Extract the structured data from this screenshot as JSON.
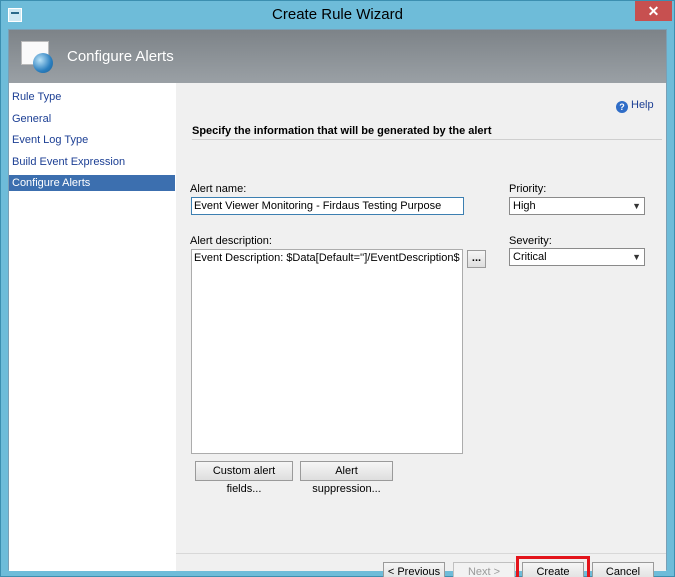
{
  "window": {
    "title": "Create Rule Wizard",
    "close_glyph": "✕"
  },
  "header": {
    "title": "Configure Alerts"
  },
  "nav": {
    "items": [
      {
        "label": "Rule Type",
        "selected": false
      },
      {
        "label": "General",
        "selected": false
      },
      {
        "label": "Event Log Type",
        "selected": false
      },
      {
        "label": "Build Event Expression",
        "selected": false
      },
      {
        "label": "Configure Alerts",
        "selected": true
      }
    ]
  },
  "content": {
    "help_label": "Help",
    "help_glyph": "?",
    "heading": "Specify the information that will be generated by the alert",
    "alert_name_label": "Alert name:",
    "alert_name_value": "Event Viewer Monitoring - Firdaus Testing Purpose",
    "priority_label": "Priority:",
    "priority_value": "High",
    "alert_description_label": "Alert description:",
    "alert_description_value": "Event Description: $Data[Default='']/EventDescription$",
    "severity_label": "Severity:",
    "severity_value": "Critical",
    "ellipsis_label": "...",
    "custom_fields_label": "Custom alert fields...",
    "suppression_label": "Alert suppression..."
  },
  "footer": {
    "previous_label": "< Previous",
    "next_label": "Next >",
    "create_label": "Create",
    "cancel_label": "Cancel"
  },
  "colors": {
    "titlebar": "#6ebcd9",
    "header_band": "#8a9095",
    "nav_selected": "#3c6faf",
    "highlight_box": "#e3141b",
    "close_button": "#c75050"
  },
  "icons": {
    "window_icon": "wizard-window-icon",
    "header_icon": "alert-sphere-icon",
    "help_icon": "help-circle-icon",
    "dropdown_icon": "chevron-down-icon"
  }
}
